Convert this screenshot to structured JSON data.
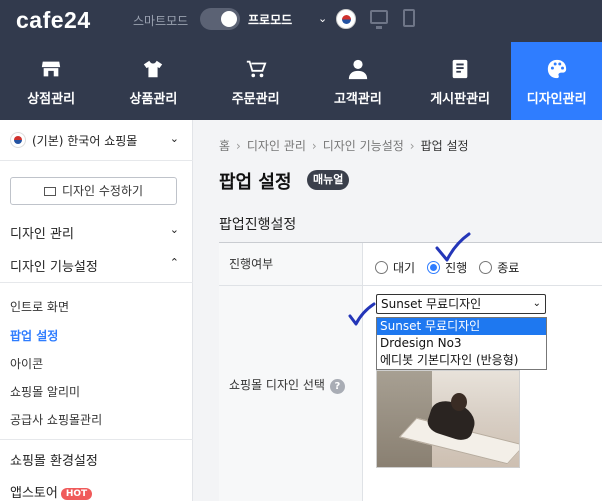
{
  "topbar": {
    "logo": "cafe24",
    "smart_mode_label": "스마트모드",
    "pro_mode_label": "프로모드",
    "dropdown_chevron": "⌄"
  },
  "nav": {
    "items": [
      {
        "label": "상점관리",
        "icon": "store-icon"
      },
      {
        "label": "상품관리",
        "icon": "tshirt-icon"
      },
      {
        "label": "주문관리",
        "icon": "cart-icon"
      },
      {
        "label": "고객관리",
        "icon": "person-icon"
      },
      {
        "label": "게시판관리",
        "icon": "board-icon"
      },
      {
        "label": "디자인관리",
        "icon": "palette-icon",
        "active": true
      }
    ],
    "active_color": "#2f7dff",
    "bg_color": "#323a4d"
  },
  "sidebar": {
    "mall_select": "(기본) 한국어 쇼핑몰",
    "edit_button": "디자인 수정하기",
    "design_mgmt": "디자인 관리",
    "design_function": "디자인 기능설정",
    "sub_items": [
      "인트로 화면",
      "팝업 설정",
      "아이콘",
      "쇼핑몰 알리미",
      "공급사 쇼핑몰관리"
    ],
    "active_sub": "팝업 설정",
    "mall_env": "쇼핑몰 환경설정",
    "app_store": "앱스토어",
    "hot_badge": "HOT"
  },
  "content": {
    "breadcrumb": [
      "홈",
      "디자인 관리",
      "디자인 기능설정",
      "팝업 설정"
    ],
    "breadcrumb_sep": "›",
    "page_title": "팝업 설정",
    "manual_badge": "매뉴얼",
    "section_title": "팝업진행설정",
    "progress_label": "진행여부",
    "radio_options": [
      {
        "label": "대기",
        "checked": false
      },
      {
        "label": "진행",
        "checked": true
      },
      {
        "label": "종료",
        "checked": false
      }
    ],
    "design_select_label": "쇼핑몰 디자인 선택",
    "help_glyph": "?",
    "selected_design": "Sunset 무료디자인",
    "design_options": [
      "Sunset 무료디자인",
      "Drdesign No3",
      "에디봇 기본디자인 (반응형)"
    ]
  }
}
